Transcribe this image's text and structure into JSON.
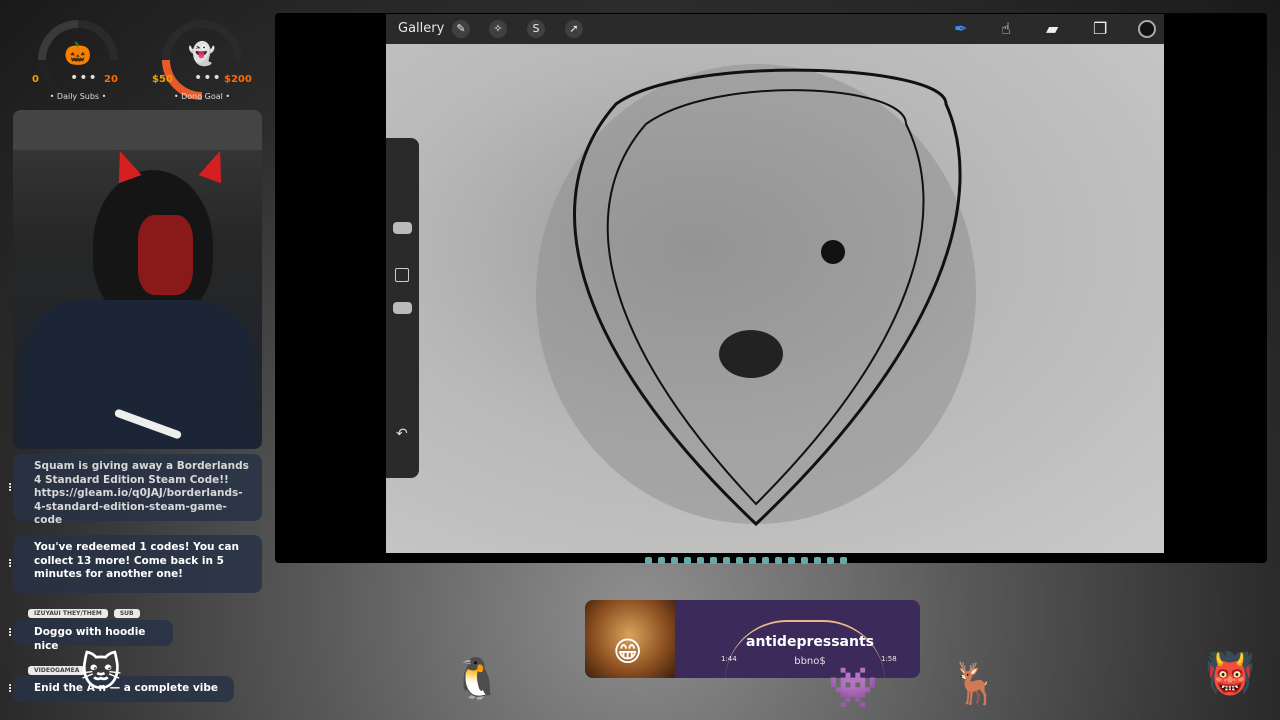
{
  "gauges": {
    "subs": {
      "min": "0",
      "dots": "•••",
      "max": "20",
      "label": "• Daily Subs •",
      "icon": "🎃",
      "icon_name": "pumpkin-icon"
    },
    "donos": {
      "min": "$50",
      "dots": "•••",
      "max": "$200",
      "label": "• Dono Goal •",
      "icon": "👻",
      "icon_name": "ghost-icon"
    }
  },
  "chat": [
    {
      "text": "Squam is giving away a Borderlands 4 Standard Edition Steam Code!! https://gleam.io/q0JAJ/borderlands-4-standard-edition-steam-game-code"
    },
    {
      "text": "You've redeemed 1 codes! You can collect 13 more! Come back in 5 minutes for another one!"
    },
    {
      "user": "IZUYAUI",
      "pronouns": "THEY/THEM",
      "badge": "SUB",
      "text": "Doggo with hoodie nice"
    },
    {
      "user": "VIDEOGAMEA",
      "text": "Enid the A      n — a complete vibe"
    }
  ],
  "app": {
    "gallery_label": "Gallery",
    "tools_left": [
      "wrench-icon",
      "magic-wand-icon",
      "selection-icon",
      "transform-icon"
    ],
    "tools_right": [
      "brush-icon",
      "smudge-icon",
      "eraser-icon",
      "layers-icon"
    ],
    "color_hex": "#111111"
  },
  "music": {
    "title": "antidepressants",
    "artist": "bbno$",
    "elapsed": "1:44",
    "duration": "1:58"
  }
}
